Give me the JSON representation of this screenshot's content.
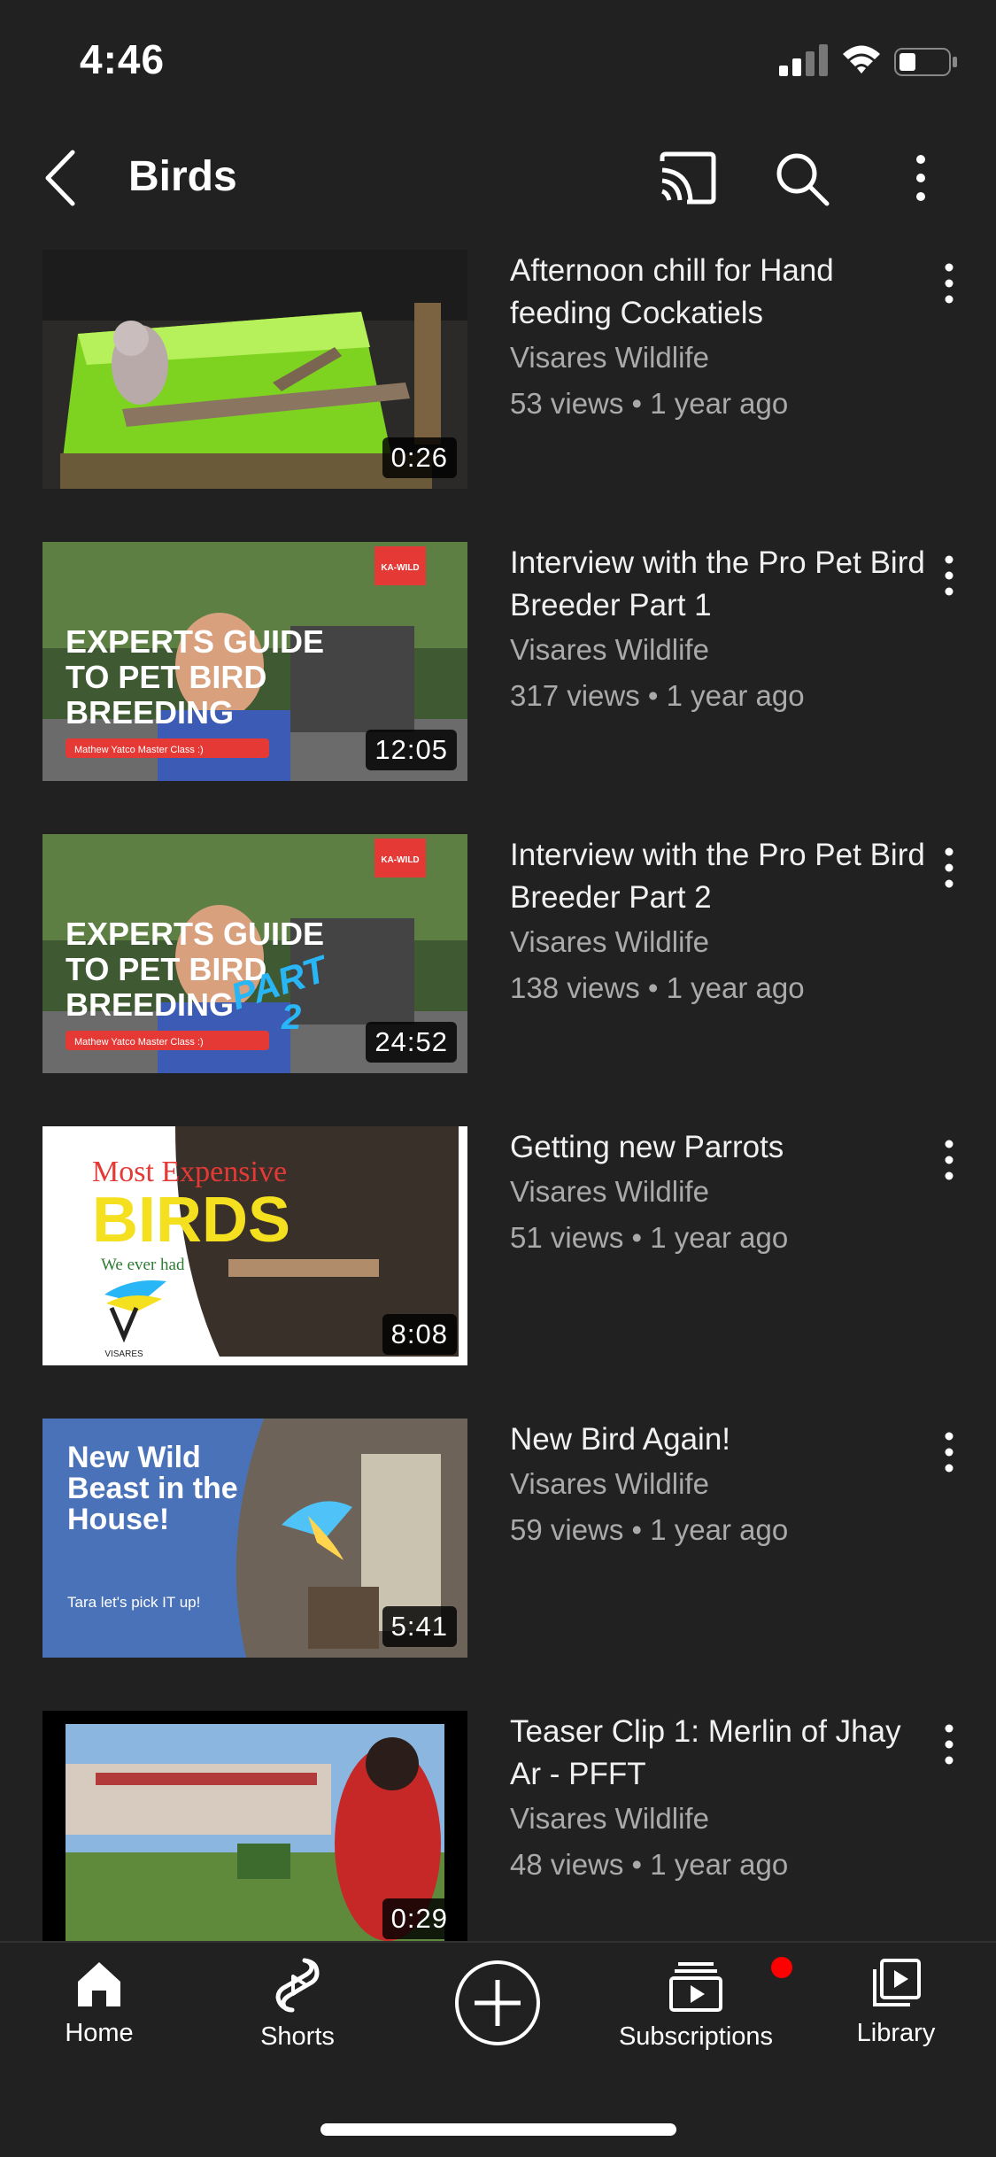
{
  "status_bar": {
    "time": "4:46"
  },
  "header": {
    "title": "Birds",
    "icons": [
      "back-arrow-icon",
      "cast-icon",
      "search-icon",
      "more-vert-icon"
    ]
  },
  "videos": [
    {
      "title": "Afternoon chill for Hand feeding Cockatiels",
      "channel": "Visares Wildlife",
      "meta": "53 views • 1 year ago",
      "duration": "0:26"
    },
    {
      "title": "Interview with the Pro Pet Bird Breeder Part 1",
      "channel": "Visares Wildlife",
      "meta": "317 views • 1 year ago",
      "duration": "12:05",
      "thumb_text": {
        "l1": "EXPERTS GUIDE",
        "l2": "TO PET BIRD",
        "l3": "BREEDING",
        "banner": "Mathew Yatco Master Class :)",
        "badge": "KA-WILD"
      }
    },
    {
      "title": "Interview with the Pro Pet Bird Breeder Part 2",
      "channel": "Visares Wildlife",
      "meta": "138 views • 1 year ago",
      "duration": "24:52",
      "thumb_text": {
        "l1": "EXPERTS GUIDE",
        "l2": "TO PET BIRD",
        "l3": "BREEDING",
        "banner": "Mathew Yatco Master Class :)",
        "badge": "KA-WILD",
        "part": "PART",
        "part_num": "2"
      }
    },
    {
      "title": "Getting new Parrots",
      "channel": "Visares Wildlife",
      "meta": "51 views • 1 year ago",
      "duration": "8:08",
      "thumb_text": {
        "l1": "Most Expensive",
        "l2": "BIRDS",
        "l3": "We ever had",
        "brand": "VISARES"
      }
    },
    {
      "title": "New Bird Again!",
      "channel": "Visares Wildlife",
      "meta": "59 views • 1 year ago",
      "duration": "5:41",
      "thumb_text": {
        "l1": "New Wild",
        "l2": "Beast in the",
        "l3": "House!",
        "sub": "Tara let's pick IT up!"
      }
    },
    {
      "title": "Teaser Clip 1: Merlin of Jhay Ar - PFFT",
      "channel": "Visares Wildlife",
      "meta": "48 views • 1 year ago",
      "duration": "0:29"
    }
  ],
  "bottom_nav": {
    "home": "Home",
    "shorts": "Shorts",
    "subscriptions": "Subscriptions",
    "library": "Library"
  },
  "colors": {
    "background": "#212121",
    "secondary_text": "#aaaaaa",
    "notification": "#ff0000"
  }
}
